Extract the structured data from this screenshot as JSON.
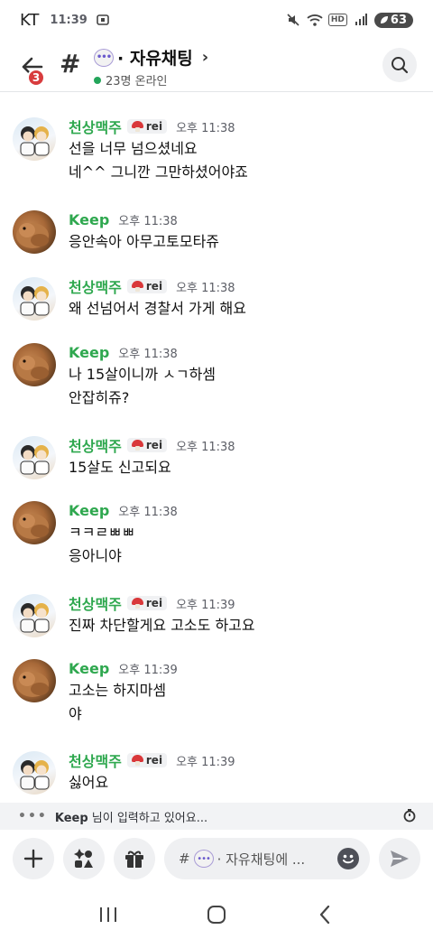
{
  "status_bar": {
    "carrier": "KT",
    "time": "11:39",
    "battery": "63",
    "icons": [
      "screenshot-icon",
      "mute-icon",
      "wifi-icon",
      "hd-icon",
      "signal-icon"
    ],
    "hd_label": "HD"
  },
  "header": {
    "unread_count": "3",
    "hash": "#",
    "channel_name": "· 자유채팅",
    "online_text": "23명 온라인"
  },
  "messages": [
    {
      "author": "천상맥주",
      "role": "rei",
      "time": "오후 11:38",
      "avatar": "couple",
      "lines": [
        "선을 너무 넘으셨네요",
        "네^^ 그니깐 그만하셨어야죠"
      ]
    },
    {
      "author": "Keep",
      "role": "",
      "time": "오후 11:38",
      "avatar": "hamster",
      "lines": [
        "응안속아 아무고토모타쥬"
      ]
    },
    {
      "author": "천상맥주",
      "role": "rei",
      "time": "오후 11:38",
      "avatar": "couple",
      "lines": [
        "왜 선넘어서 경찰서 가게 해요"
      ]
    },
    {
      "author": "Keep",
      "role": "",
      "time": "오후 11:38",
      "avatar": "hamster",
      "lines": [
        "나 15살이니까 ㅅㄱ하셈",
        "안잡히쥬?"
      ]
    },
    {
      "author": "천상맥주",
      "role": "rei",
      "time": "오후 11:38",
      "avatar": "couple",
      "lines": [
        "15살도 신고되요"
      ]
    },
    {
      "author": "Keep",
      "role": "",
      "time": "오후 11:38",
      "avatar": "hamster",
      "lines": [
        "ㅋㅋㄹㅃㅃ",
        "응아니야"
      ]
    },
    {
      "author": "천상맥주",
      "role": "rei",
      "time": "오후 11:39",
      "avatar": "couple",
      "lines": [
        "진짜 차단할게요 고소도 하고요"
      ]
    },
    {
      "author": "Keep",
      "role": "",
      "time": "오후 11:39",
      "avatar": "hamster",
      "lines": [
        "고소는 하지마셈",
        "야"
      ]
    },
    {
      "author": "천상맥주",
      "role": "rei",
      "time": "오후 11:39",
      "avatar": "couple",
      "lines": [
        "싫어요"
      ]
    }
  ],
  "typing": {
    "name": "Keep",
    "text": "님이 입력하고 있어요..."
  },
  "composer": {
    "hash": "#",
    "placeholder": "· 자유채팅에 ..."
  },
  "colors": {
    "author_green": "#2fa84f",
    "badge_red": "#d83c3e",
    "online_green": "#23a55a"
  }
}
